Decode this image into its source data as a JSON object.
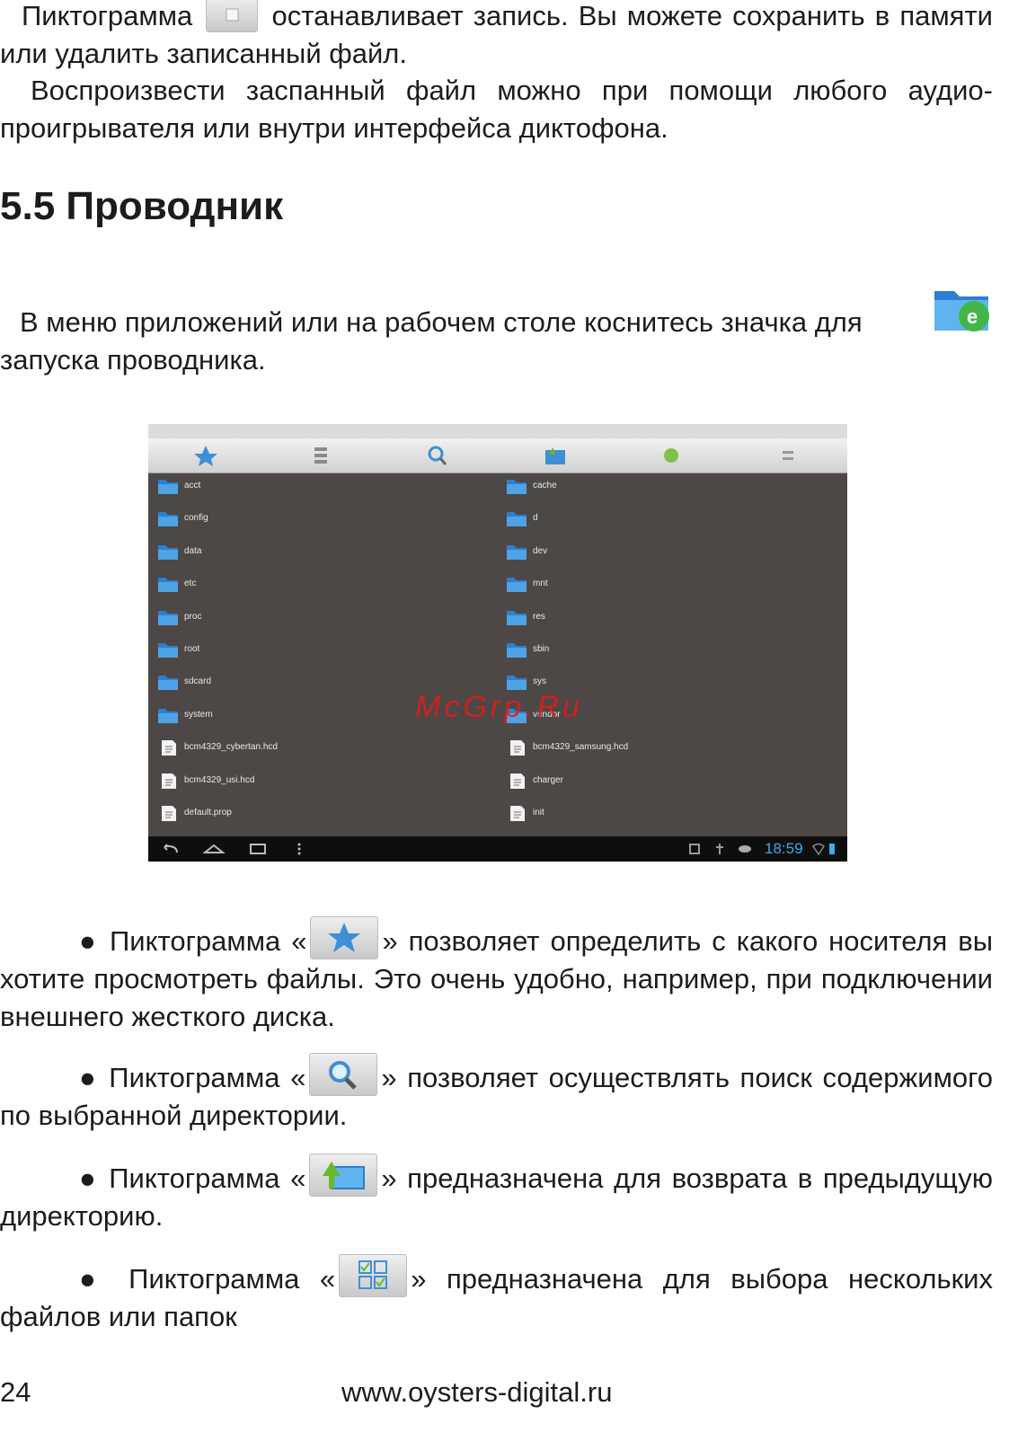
{
  "intro": {
    "line1_a": "Пиктограмма",
    "line1_b": "останавливает запись.  Вы можете сохранить в памяти или удалить записанный файл.",
    "para2": "Воспроизвести заспанный файл можно при помощи любого аудио-проигрывателя или внутри интерфейса диктофона."
  },
  "section_title": "5.5 Проводник",
  "launch_text": "В меню приложений или на рабочем столе коснитесь значка для запуска проводника.",
  "screenshot": {
    "left_items": [
      {
        "name": "acct",
        "type": "folder"
      },
      {
        "name": "config",
        "type": "folder"
      },
      {
        "name": "data",
        "type": "folder"
      },
      {
        "name": "etc",
        "type": "folder"
      },
      {
        "name": "proc",
        "type": "folder"
      },
      {
        "name": "root",
        "type": "folder"
      },
      {
        "name": "sdcard",
        "type": "folder"
      },
      {
        "name": "system",
        "type": "folder"
      },
      {
        "name": "bcm4329_cybertan.hcd",
        "type": "file"
      },
      {
        "name": "bcm4329_usi.hcd",
        "type": "file"
      },
      {
        "name": "default.prop",
        "type": "file"
      }
    ],
    "right_items": [
      {
        "name": "cache",
        "type": "folder"
      },
      {
        "name": "d",
        "type": "folder"
      },
      {
        "name": "dev",
        "type": "folder"
      },
      {
        "name": "mnt",
        "type": "folder"
      },
      {
        "name": "res",
        "type": "folder"
      },
      {
        "name": "sbin",
        "type": "folder"
      },
      {
        "name": "sys",
        "type": "folder"
      },
      {
        "name": "vendor",
        "type": "folder"
      },
      {
        "name": "bcm4329_samsung.hcd",
        "type": "file"
      },
      {
        "name": "charger",
        "type": "file"
      },
      {
        "name": "init",
        "type": "file"
      }
    ],
    "clock": "18:59"
  },
  "watermark": "McGrp.Ru",
  "bullets": {
    "b1_a": "● Пиктограмма «",
    "b1_b": "» позволяет определить с какого носителя вы хотите просмотреть файлы. Это очень удобно, например, при подключении внешнего жесткого диска.",
    "b2_a": "● Пиктограмма «",
    "b2_b": "» позволяет осуществлять поиск содержимого по выбранной директории.",
    "b3_a": "● Пиктограмма «",
    "b3_b": "» предназначена для возврата в предыдущую директорию.",
    "b4_a": "● Пиктограмма «",
    "b4_b": "» предназначена для выбора нескольких файлов или папок"
  },
  "footer": {
    "page_number": "24",
    "url": "www.oysters-digital.ru"
  },
  "colors": {
    "folder_blue": "#3f8fd6",
    "fm_background": "#4d4845",
    "clock_blue": "#3ea8e8",
    "watermark_red": "#e31c1c"
  }
}
